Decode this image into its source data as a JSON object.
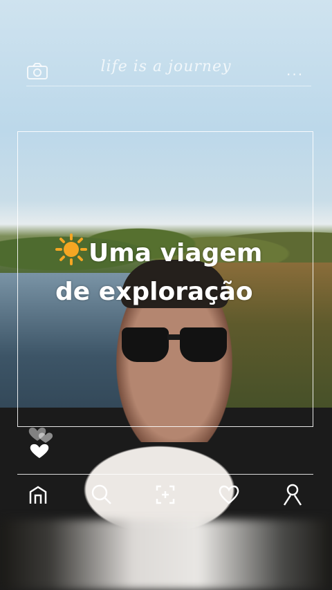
{
  "story": {
    "header_title": "life is a journey",
    "menu_dots": "...",
    "caption_line1": "Uma viagem",
    "caption_line2": "de exploração"
  },
  "nav": {
    "items": [
      "home-icon",
      "search-icon",
      "add-post-icon",
      "heart-icon",
      "profile-icon"
    ]
  },
  "colors": {
    "frame": "#ffffff",
    "text": "#ffffff",
    "sun": "#f5a623"
  }
}
